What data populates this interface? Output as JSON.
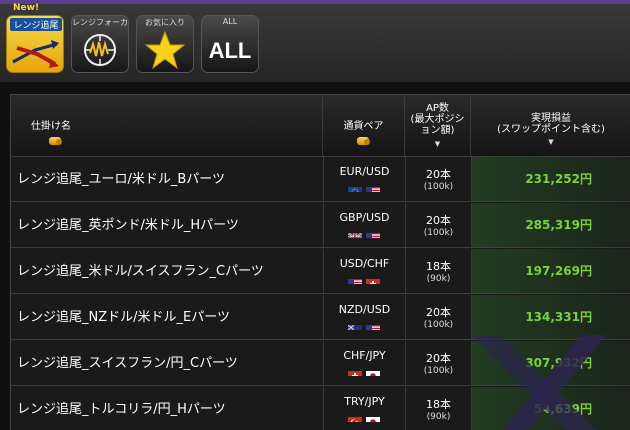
{
  "tabs": [
    {
      "id": "range",
      "label": "レンジ追尾",
      "badge": "New!",
      "icon": "range-tracking-icon",
      "active": true
    },
    {
      "id": "focus",
      "label": "レンジフォーカス",
      "icon": "range-focus-icon",
      "active": false
    },
    {
      "id": "favorites",
      "label": "お気に入り",
      "icon": "star-icon",
      "active": false
    },
    {
      "id": "all",
      "label": "ALL",
      "glyph": "ALL",
      "icon": "all-icon",
      "active": false
    }
  ],
  "table": {
    "headers": {
      "name": "仕掛け名",
      "pair": "通貨ペア",
      "ap_line1": "AP数",
      "ap_line2": "(最大ポジシ",
      "ap_line3": "ョン額)",
      "pl_line1": "実現損益",
      "pl_line2": "(スワップポイント含む)"
    },
    "rows": [
      {
        "name": "レンジ追尾_ユーロ/米ドル_Bパーツ",
        "pair": "EUR/USD",
        "flags": [
          "eu",
          "us"
        ],
        "ap": "20本",
        "max": "(100k)",
        "pl": "231,252円"
      },
      {
        "name": "レンジ追尾_英ポンド/米ドル_Hパーツ",
        "pair": "GBP/USD",
        "flags": [
          "gb",
          "us"
        ],
        "ap": "20本",
        "max": "(100k)",
        "pl": "285,319円"
      },
      {
        "name": "レンジ追尾_米ドル/スイスフラン_Cパーツ",
        "pair": "USD/CHF",
        "flags": [
          "us",
          "ch"
        ],
        "ap": "18本",
        "max": "(90k)",
        "pl": "197,269円"
      },
      {
        "name": "レンジ追尾_NZドル/米ドル_Eパーツ",
        "pair": "NZD/USD",
        "flags": [
          "nz",
          "us"
        ],
        "ap": "20本",
        "max": "(100k)",
        "pl": "134,331円"
      },
      {
        "name": "レンジ追尾_スイスフラン/円_Cパーツ",
        "pair": "CHF/JPY",
        "flags": [
          "ch",
          "jp"
        ],
        "ap": "20本",
        "max": "(100k)",
        "pl": "307,932円"
      },
      {
        "name": "レンジ追尾_トルコリラ/円_Hパーツ",
        "pair": "TRY/JPY",
        "flags": [
          "tr",
          "jp"
        ],
        "ap": "18本",
        "max": "(90k)",
        "pl": "54,639円"
      }
    ]
  },
  "colors": {
    "accent_yellow": "#f2c21f",
    "profit_green": "#7cd03a",
    "header_purple": "#5a3f8e"
  }
}
